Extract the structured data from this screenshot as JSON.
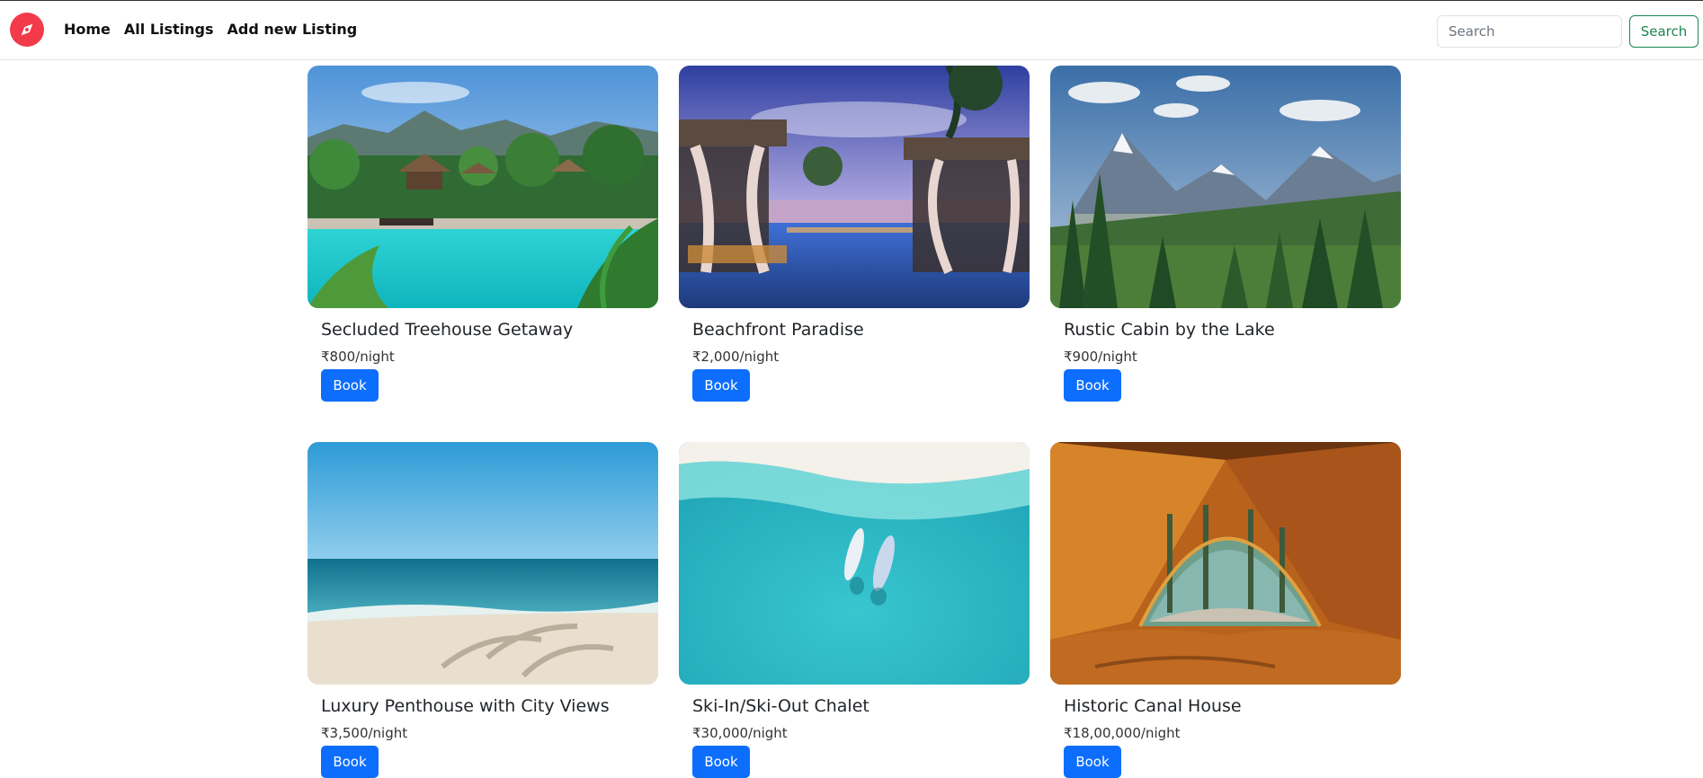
{
  "navbar": {
    "brand_icon": "compass-icon",
    "links": [
      "Home",
      "All Listings",
      "Add new Listing"
    ],
    "search": {
      "placeholder": "Search",
      "value": "",
      "button_label": "Search"
    }
  },
  "colors": {
    "brand": "#f23a4a",
    "primary_button": "#0d6efd",
    "search_button": "#198754"
  },
  "listings": [
    {
      "title": "Secluded Treehouse Getaway",
      "price": "₹800/night",
      "button": "Book",
      "image": "tropical-resort-pool"
    },
    {
      "title": "Beachfront Paradise",
      "price": "₹2,000/night",
      "button": "Book",
      "image": "beachfront-cabanas-pool"
    },
    {
      "title": "Rustic Cabin by the Lake",
      "price": "₹900/night",
      "button": "Book",
      "image": "mountain-lake-forest"
    },
    {
      "title": "Luxury Penthouse with City Views",
      "price": "₹3,500/night",
      "button": "Book",
      "image": "sandy-beach-ocean"
    },
    {
      "title": "Ski-In/Ski-Out Chalet",
      "price": "₹30,000/night",
      "button": "Book",
      "image": "boats-turquoise-water"
    },
    {
      "title": "Historic Canal House",
      "price": "₹18,00,000/night",
      "button": "Book",
      "image": "tent-forest-view"
    }
  ]
}
